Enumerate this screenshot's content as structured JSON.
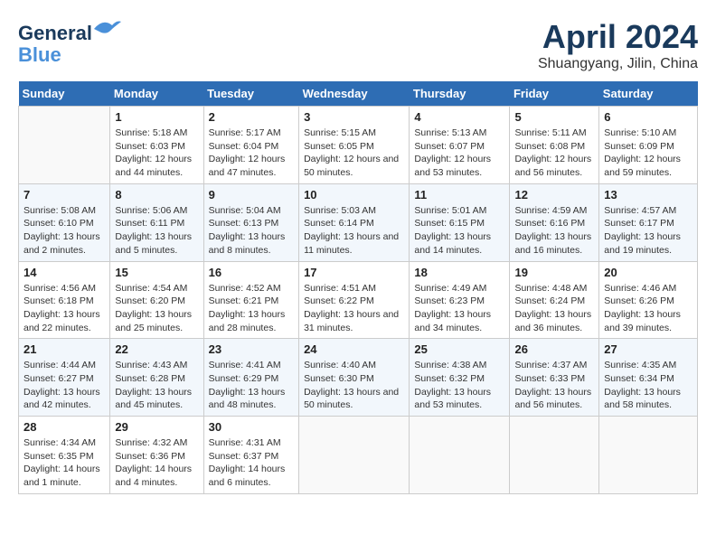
{
  "header": {
    "logo_line1": "General",
    "logo_line2": "Blue",
    "title": "April 2024",
    "subtitle": "Shuangyang, Jilin, China"
  },
  "columns": [
    "Sunday",
    "Monday",
    "Tuesday",
    "Wednesday",
    "Thursday",
    "Friday",
    "Saturday"
  ],
  "weeks": [
    [
      {
        "day": "",
        "info": ""
      },
      {
        "day": "1",
        "info": "Sunrise: 5:18 AM\nSunset: 6:03 PM\nDaylight: 12 hours\nand 44 minutes."
      },
      {
        "day": "2",
        "info": "Sunrise: 5:17 AM\nSunset: 6:04 PM\nDaylight: 12 hours\nand 47 minutes."
      },
      {
        "day": "3",
        "info": "Sunrise: 5:15 AM\nSunset: 6:05 PM\nDaylight: 12 hours\nand 50 minutes."
      },
      {
        "day": "4",
        "info": "Sunrise: 5:13 AM\nSunset: 6:07 PM\nDaylight: 12 hours\nand 53 minutes."
      },
      {
        "day": "5",
        "info": "Sunrise: 5:11 AM\nSunset: 6:08 PM\nDaylight: 12 hours\nand 56 minutes."
      },
      {
        "day": "6",
        "info": "Sunrise: 5:10 AM\nSunset: 6:09 PM\nDaylight: 12 hours\nand 59 minutes."
      }
    ],
    [
      {
        "day": "7",
        "info": "Sunrise: 5:08 AM\nSunset: 6:10 PM\nDaylight: 13 hours\nand 2 minutes."
      },
      {
        "day": "8",
        "info": "Sunrise: 5:06 AM\nSunset: 6:11 PM\nDaylight: 13 hours\nand 5 minutes."
      },
      {
        "day": "9",
        "info": "Sunrise: 5:04 AM\nSunset: 6:13 PM\nDaylight: 13 hours\nand 8 minutes."
      },
      {
        "day": "10",
        "info": "Sunrise: 5:03 AM\nSunset: 6:14 PM\nDaylight: 13 hours\nand 11 minutes."
      },
      {
        "day": "11",
        "info": "Sunrise: 5:01 AM\nSunset: 6:15 PM\nDaylight: 13 hours\nand 14 minutes."
      },
      {
        "day": "12",
        "info": "Sunrise: 4:59 AM\nSunset: 6:16 PM\nDaylight: 13 hours\nand 16 minutes."
      },
      {
        "day": "13",
        "info": "Sunrise: 4:57 AM\nSunset: 6:17 PM\nDaylight: 13 hours\nand 19 minutes."
      }
    ],
    [
      {
        "day": "14",
        "info": "Sunrise: 4:56 AM\nSunset: 6:18 PM\nDaylight: 13 hours\nand 22 minutes."
      },
      {
        "day": "15",
        "info": "Sunrise: 4:54 AM\nSunset: 6:20 PM\nDaylight: 13 hours\nand 25 minutes."
      },
      {
        "day": "16",
        "info": "Sunrise: 4:52 AM\nSunset: 6:21 PM\nDaylight: 13 hours\nand 28 minutes."
      },
      {
        "day": "17",
        "info": "Sunrise: 4:51 AM\nSunset: 6:22 PM\nDaylight: 13 hours\nand 31 minutes."
      },
      {
        "day": "18",
        "info": "Sunrise: 4:49 AM\nSunset: 6:23 PM\nDaylight: 13 hours\nand 34 minutes."
      },
      {
        "day": "19",
        "info": "Sunrise: 4:48 AM\nSunset: 6:24 PM\nDaylight: 13 hours\nand 36 minutes."
      },
      {
        "day": "20",
        "info": "Sunrise: 4:46 AM\nSunset: 6:26 PM\nDaylight: 13 hours\nand 39 minutes."
      }
    ],
    [
      {
        "day": "21",
        "info": "Sunrise: 4:44 AM\nSunset: 6:27 PM\nDaylight: 13 hours\nand 42 minutes."
      },
      {
        "day": "22",
        "info": "Sunrise: 4:43 AM\nSunset: 6:28 PM\nDaylight: 13 hours\nand 45 minutes."
      },
      {
        "day": "23",
        "info": "Sunrise: 4:41 AM\nSunset: 6:29 PM\nDaylight: 13 hours\nand 48 minutes."
      },
      {
        "day": "24",
        "info": "Sunrise: 4:40 AM\nSunset: 6:30 PM\nDaylight: 13 hours\nand 50 minutes."
      },
      {
        "day": "25",
        "info": "Sunrise: 4:38 AM\nSunset: 6:32 PM\nDaylight: 13 hours\nand 53 minutes."
      },
      {
        "day": "26",
        "info": "Sunrise: 4:37 AM\nSunset: 6:33 PM\nDaylight: 13 hours\nand 56 minutes."
      },
      {
        "day": "27",
        "info": "Sunrise: 4:35 AM\nSunset: 6:34 PM\nDaylight: 13 hours\nand 58 minutes."
      }
    ],
    [
      {
        "day": "28",
        "info": "Sunrise: 4:34 AM\nSunset: 6:35 PM\nDaylight: 14 hours\nand 1 minute."
      },
      {
        "day": "29",
        "info": "Sunrise: 4:32 AM\nSunset: 6:36 PM\nDaylight: 14 hours\nand 4 minutes."
      },
      {
        "day": "30",
        "info": "Sunrise: 4:31 AM\nSunset: 6:37 PM\nDaylight: 14 hours\nand 6 minutes."
      },
      {
        "day": "",
        "info": ""
      },
      {
        "day": "",
        "info": ""
      },
      {
        "day": "",
        "info": ""
      },
      {
        "day": "",
        "info": ""
      }
    ]
  ]
}
